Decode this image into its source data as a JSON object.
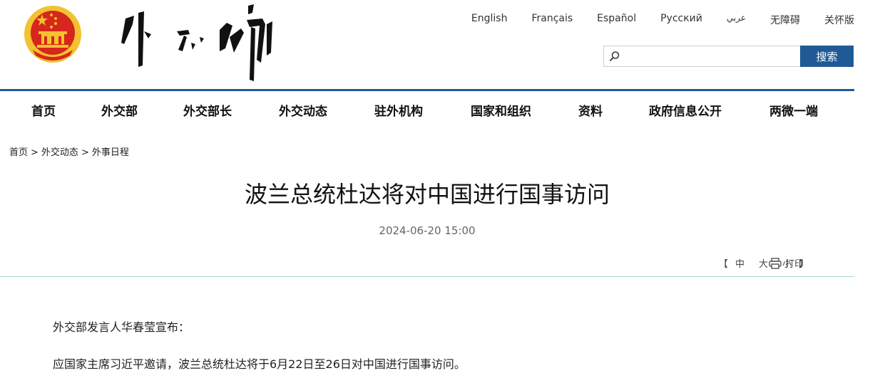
{
  "header": {
    "lang_links": [
      "English",
      "Français",
      "Español",
      "Русский",
      "عربي",
      "无障碍",
      "关怀版"
    ],
    "search": {
      "placeholder": "",
      "button_label": "搜索"
    }
  },
  "nav": {
    "items": [
      "首页",
      "外交部",
      "外交部长",
      "外交动态",
      "驻外机构",
      "国家和组织",
      "资料",
      "政府信息公开",
      "两微一端"
    ]
  },
  "breadcrumb": {
    "items": [
      "首页",
      "外交动态",
      "外事日程"
    ],
    "separator": ">"
  },
  "article": {
    "title": "波兰总统杜达将对中国进行国事访问",
    "date": "2024-06-20 15:00",
    "font_size_options": [
      "中",
      "大",
      "小"
    ],
    "bracket_open": "【",
    "bracket_close": "】",
    "print_label": "打印",
    "paragraphs": [
      "外交部发言人华春莹宣布：",
      "应国家主席习近平邀请，波兰总统杜达将于6月22日至26日对中国进行国事访问。"
    ]
  },
  "colors": {
    "brand_blue": "#1f5a96",
    "emblem_red": "#d7261b",
    "emblem_gold": "#f2c230",
    "divider": "#a9d7d4"
  },
  "icons": {
    "emblem": "national-emblem-logo",
    "calligraphy": "ministry-calligraphy-logo",
    "search": "search-icon",
    "print": "printer-icon"
  }
}
